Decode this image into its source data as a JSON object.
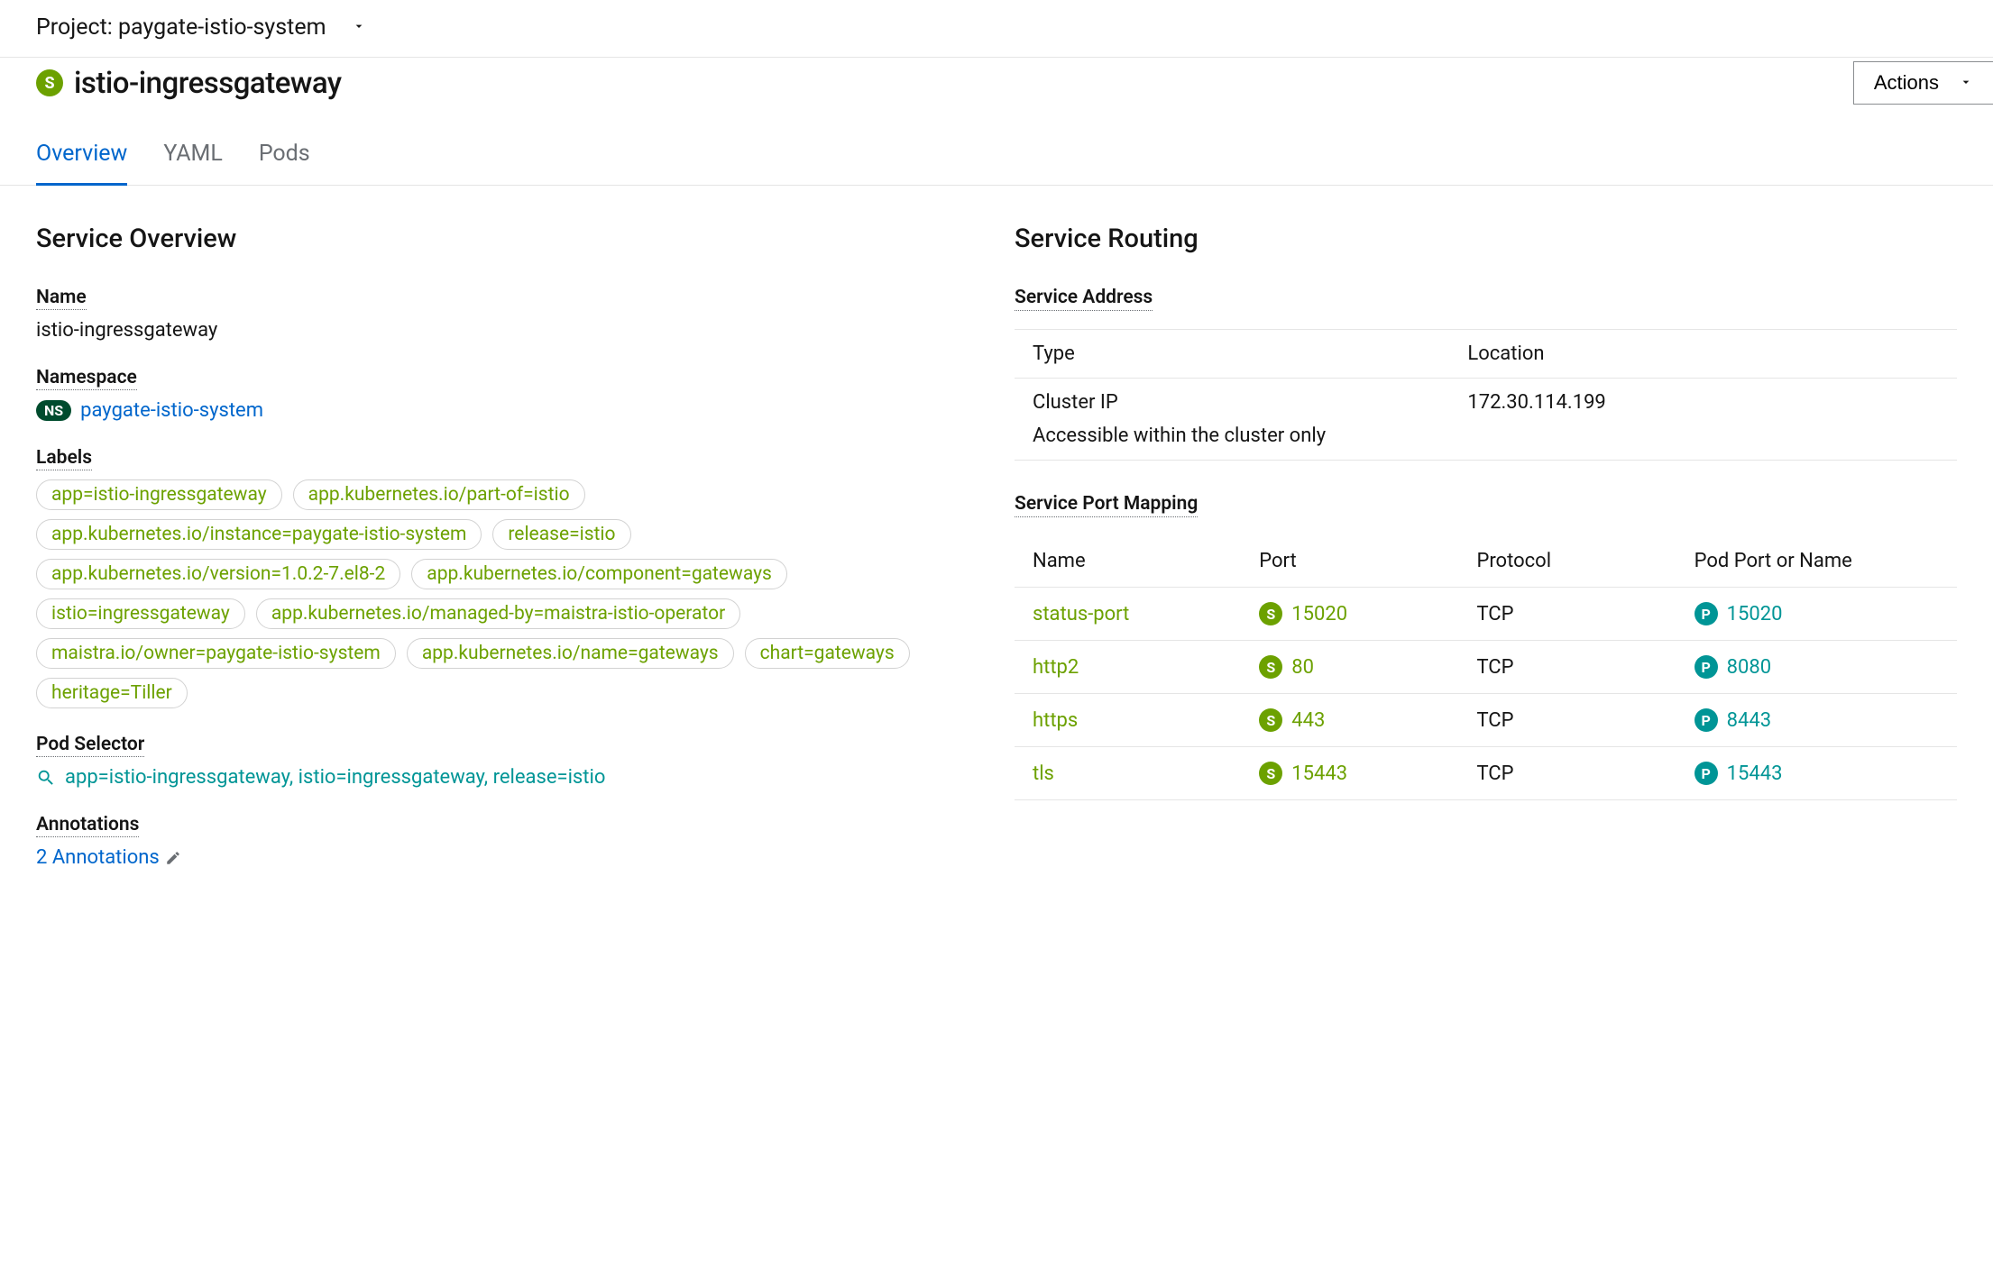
{
  "project_bar": {
    "label": "Project: paygate-istio-system"
  },
  "title": {
    "badge": "S",
    "name": "istio-ingressgateway",
    "actions_label": "Actions"
  },
  "tabs": [
    {
      "id": "overview",
      "label": "Overview",
      "active": true
    },
    {
      "id": "yaml",
      "label": "YAML",
      "active": false
    },
    {
      "id": "pods",
      "label": "Pods",
      "active": false
    }
  ],
  "overview": {
    "heading": "Service Overview",
    "fields": {
      "name_label": "Name",
      "name_value": "istio-ingressgateway",
      "namespace_label": "Namespace",
      "namespace_badge": "NS",
      "namespace_value": "paygate-istio-system",
      "labels_label": "Labels",
      "labels": [
        "app=istio-ingressgateway",
        "app.kubernetes.io/part-of=istio",
        "app.kubernetes.io/instance=paygate-istio-system",
        "release=istio",
        "app.kubernetes.io/version=1.0.2-7.el8-2",
        "app.kubernetes.io/component=gateways",
        "istio=ingressgateway",
        "app.kubernetes.io/managed-by=maistra-istio-operator",
        "maistra.io/owner=paygate-istio-system",
        "app.kubernetes.io/name=gateways",
        "chart=gateways",
        "heritage=Tiller"
      ],
      "pod_selector_label": "Pod Selector",
      "pod_selector_value": "app=istio-ingressgateway, istio=ingressgateway, release=istio",
      "annotations_label": "Annotations",
      "annotations_value": "2 Annotations"
    }
  },
  "routing": {
    "heading": "Service Routing",
    "address": {
      "label": "Service Address",
      "col_type": "Type",
      "col_location": "Location",
      "type_value": "Cluster IP",
      "location_value": "172.30.114.199",
      "note": "Accessible within the cluster only"
    },
    "port_mapping": {
      "label": "Service Port Mapping",
      "columns": {
        "name": "Name",
        "port": "Port",
        "protocol": "Protocol",
        "pod_port": "Pod Port or Name"
      },
      "rows": [
        {
          "name": "status-port",
          "port": "15020",
          "protocol": "TCP",
          "pod_port": "15020"
        },
        {
          "name": "http2",
          "port": "80",
          "protocol": "TCP",
          "pod_port": "8080"
        },
        {
          "name": "https",
          "port": "443",
          "protocol": "TCP",
          "pod_port": "8443"
        },
        {
          "name": "tls",
          "port": "15443",
          "protocol": "TCP",
          "pod_port": "15443"
        }
      ]
    }
  }
}
